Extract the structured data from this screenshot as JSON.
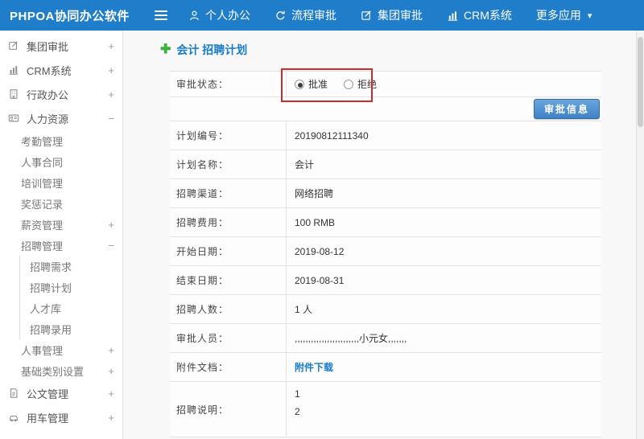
{
  "colors": {
    "topbar_blue": "#1f7dc9",
    "title_blue": "#1a7bc9",
    "plus_green": "#3bb33b",
    "annotation_red": "#cc2b2b",
    "button_blue": "#3f82c4"
  },
  "topbar": {
    "app_title": "PHPOA协同办公软件",
    "nav": [
      {
        "label": "个人办公",
        "icon": "person-icon"
      },
      {
        "label": "流程审批",
        "icon": "process-cycle-icon"
      },
      {
        "label": "集团审批",
        "icon": "edit-square-icon"
      },
      {
        "label": "CRM系统",
        "icon": "bar-chart-icon"
      },
      {
        "label": "更多应用",
        "icon": "caret-down-icon",
        "caret": "▾"
      }
    ]
  },
  "sidebar": {
    "items": [
      {
        "label": "集团审批",
        "toggle": "+",
        "level": 0,
        "icon": "edit-square-icon"
      },
      {
        "label": "CRM系统",
        "toggle": "+",
        "level": 0,
        "icon": "bar-chart-icon"
      },
      {
        "label": "行政办公",
        "toggle": "+",
        "level": 0,
        "icon": "building-icon"
      },
      {
        "label": "人力资源",
        "toggle": "−",
        "level": 0,
        "icon": "id-card-icon"
      },
      {
        "label": "考勤管理",
        "level": 1
      },
      {
        "label": "人事合同",
        "level": 1
      },
      {
        "label": "培训管理",
        "level": 1
      },
      {
        "label": "奖惩记录",
        "level": 1
      },
      {
        "label": "薪资管理",
        "toggle": "+",
        "level": 1
      },
      {
        "label": "招聘管理",
        "toggle": "−",
        "level": 1
      },
      {
        "label": "招聘需求",
        "level": 2
      },
      {
        "label": "招聘计划",
        "level": 2
      },
      {
        "label": "人才库",
        "level": 2
      },
      {
        "label": "招聘录用",
        "level": 2
      },
      {
        "label": "人事管理",
        "toggle": "+",
        "level": 1
      },
      {
        "label": "基础类别设置",
        "toggle": "+",
        "level": 1
      },
      {
        "label": "公文管理",
        "toggle": "+",
        "level": 0,
        "icon": "document-icon"
      },
      {
        "label": "用车管理",
        "toggle": "+",
        "level": 0,
        "icon": "car-icon"
      }
    ]
  },
  "main": {
    "page_title": "会计 招聘计划",
    "approval": {
      "label": "审批状态：",
      "options": [
        {
          "label": "批准",
          "checked": true
        },
        {
          "label": "拒绝",
          "checked": false
        }
      ]
    },
    "approve_button_label": "审批信息",
    "fields": [
      {
        "label": "计划编号：",
        "value": "20190812111340"
      },
      {
        "label": "计划名称：",
        "value": "会计"
      },
      {
        "label": "招聘渠道：",
        "value": "网络招聘"
      },
      {
        "label": "招聘费用：",
        "value": "100 RMB"
      },
      {
        "label": "开始日期：",
        "value": "2019-08-12"
      },
      {
        "label": "结束日期：",
        "value": "2019-08-31"
      },
      {
        "label": "招聘人数：",
        "value": "1 人"
      },
      {
        "label": "审批人员：",
        "value": ",,,,,,,,,,,,,,,,,,,,,,,,小元女,,,,,,,"
      },
      {
        "label": "附件文档：",
        "value": "附件下载"
      },
      {
        "label": "招聘说明：",
        "value_lines": {
          "0": "1",
          "1": "2"
        }
      }
    ]
  }
}
